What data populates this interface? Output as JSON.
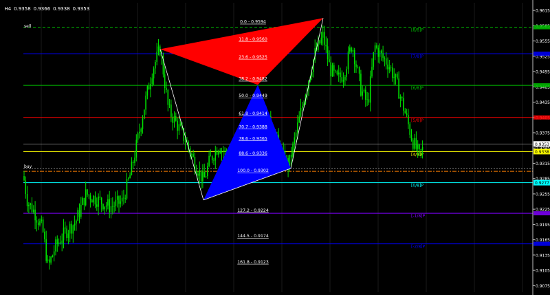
{
  "header": {
    "timeframe": "H4",
    "open": "0.9358",
    "high": "0.9366",
    "low": "0.9338",
    "close": "0.9353"
  },
  "colors": {
    "background": "#000000",
    "candle": "#00e000",
    "bull_triangle": "#0000ff",
    "bear_triangle": "#ff0000",
    "grid": "#1a1a1a"
  },
  "price_axis": {
    "min": 0.9062,
    "max": 0.963,
    "ticks": [
      "0.9615",
      "0.9585",
      "0.9555",
      "0.9525",
      "0.9495",
      "0.9465",
      "0.9435",
      "0.9405",
      "0.9375",
      "0.9345",
      "0.9315",
      "0.9285",
      "0.9255",
      "0.9225",
      "0.9195",
      "0.9165",
      "0.9135",
      "0.9105",
      "0.9075"
    ]
  },
  "price_boxes": [
    {
      "label": "0.9353",
      "price": 0.9353,
      "bg": "#ffffff",
      "fg": "#000000"
    },
    {
      "label": "0.9338",
      "price": 0.9338,
      "bg": "#ffff00",
      "fg": "#000000"
    },
    {
      "label": "0.9277",
      "price": 0.9277,
      "bg": "#00ffff",
      "fg": "#000000"
    }
  ],
  "fib_levels": [
    {
      "label": "0.0 - 0.9594",
      "price": 0.9594
    },
    {
      "label": "11.8 - 0.9560",
      "price": 0.956
    },
    {
      "label": "23.6 - 0.9525",
      "price": 0.9525
    },
    {
      "label": "38.2 - 0.9482",
      "price": 0.9482
    },
    {
      "label": "50.0 - 0.9449",
      "price": 0.9449
    },
    {
      "label": "61.8 - 0.9414",
      "price": 0.9414
    },
    {
      "label": "70.7 - 0.9388",
      "price": 0.9388
    },
    {
      "label": "78.6 - 0.9365",
      "price": 0.9365
    },
    {
      "label": "88.6 - 0.9336",
      "price": 0.9336
    },
    {
      "label": "100.0 - 0.9302",
      "price": 0.9302
    },
    {
      "label": "127.2 - 0.9224",
      "price": 0.9224
    },
    {
      "label": "144.5 - 0.9174",
      "price": 0.9174
    },
    {
      "label": "161.8 - 0.9123",
      "price": 0.9123
    }
  ],
  "murrey_lines": [
    {
      "label": "[8/8]P",
      "price": 0.9582,
      "color": "#00c000",
      "dash": true
    },
    {
      "label": "[7/8]P",
      "price": 0.953,
      "color": "#0000ff",
      "dash": false
    },
    {
      "label": "[6/8]P",
      "price": 0.9468,
      "color": "#00c000",
      "dash": false
    },
    {
      "label": "[5/8]P",
      "price": 0.9405,
      "color": "#ff0000",
      "dash": false
    },
    {
      "label": "[4/8]P",
      "price": 0.9338,
      "color": "#ffff00",
      "dash": false
    },
    {
      "label": "[0/8]P",
      "price": 0.9277,
      "color": "#00ffff",
      "dash": false
    },
    {
      "label": "[-1/8]P",
      "price": 0.9217,
      "color": "#8000ff",
      "dash": false
    },
    {
      "label": "[-2/8]P",
      "price": 0.9157,
      "color": "#0000ff",
      "dash": false
    }
  ],
  "signals": {
    "sell_label": "sell",
    "sell_price": 0.9583,
    "buy_label": "buy",
    "buy_price": 0.9302
  }
}
